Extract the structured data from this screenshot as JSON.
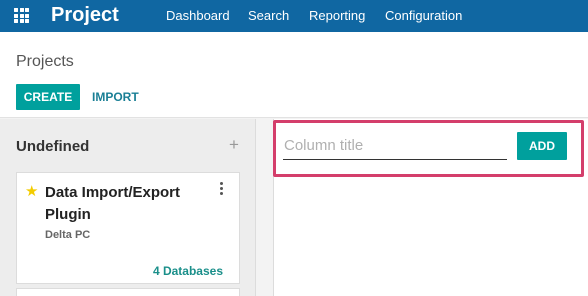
{
  "app": {
    "title": "Project"
  },
  "nav": {
    "items": [
      "Dashboard",
      "Search",
      "Reporting",
      "Configuration"
    ]
  },
  "breadcrumb": "Projects",
  "buttons": {
    "create": "CREATE",
    "import": "IMPORT"
  },
  "column": {
    "title": "Undefined",
    "add_symbol": "+",
    "card": {
      "favorite": true,
      "title": "Data Import/Export Plugin",
      "subtitle": "Delta PC",
      "link": "4 Databases"
    }
  },
  "new_column": {
    "placeholder": "Column title",
    "value": "",
    "add_label": "ADD"
  },
  "colors": {
    "navbar": "#1067a2",
    "primary": "#00a09d",
    "highlight": "#d43e6b",
    "star": "#f3cc00"
  }
}
